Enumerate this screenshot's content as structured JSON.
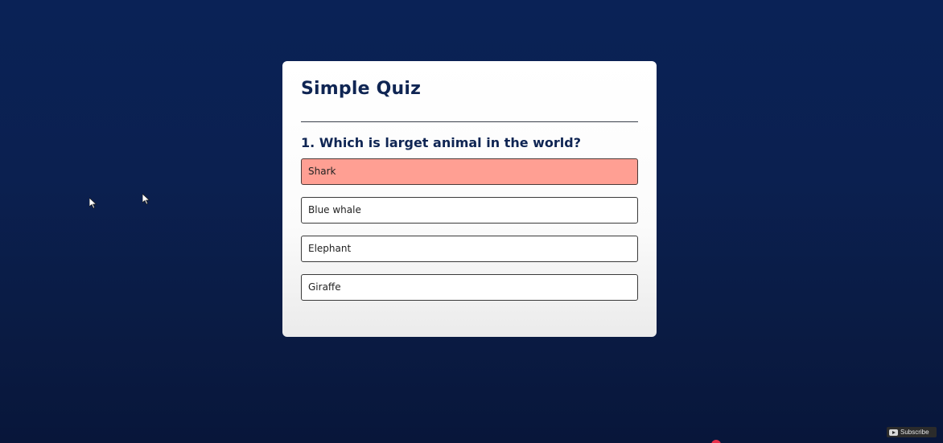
{
  "quiz": {
    "title": "Simple Quiz",
    "question": "1. Which is larget animal in the world?",
    "answers": [
      {
        "label": "Shark",
        "state": "wrong"
      },
      {
        "label": "Blue whale",
        "state": "default"
      },
      {
        "label": "Elephant",
        "state": "default"
      },
      {
        "label": "Giraffe",
        "state": "default"
      }
    ]
  },
  "overlay": {
    "subscribe_label": "Subscribe"
  },
  "colors": {
    "background": "#0b2050",
    "card": "#ffffff",
    "heading": "#0f2553",
    "wrong_answer": "#ff9f93"
  },
  "icons": [
    "cursor-icon",
    "youtube-icon"
  ]
}
